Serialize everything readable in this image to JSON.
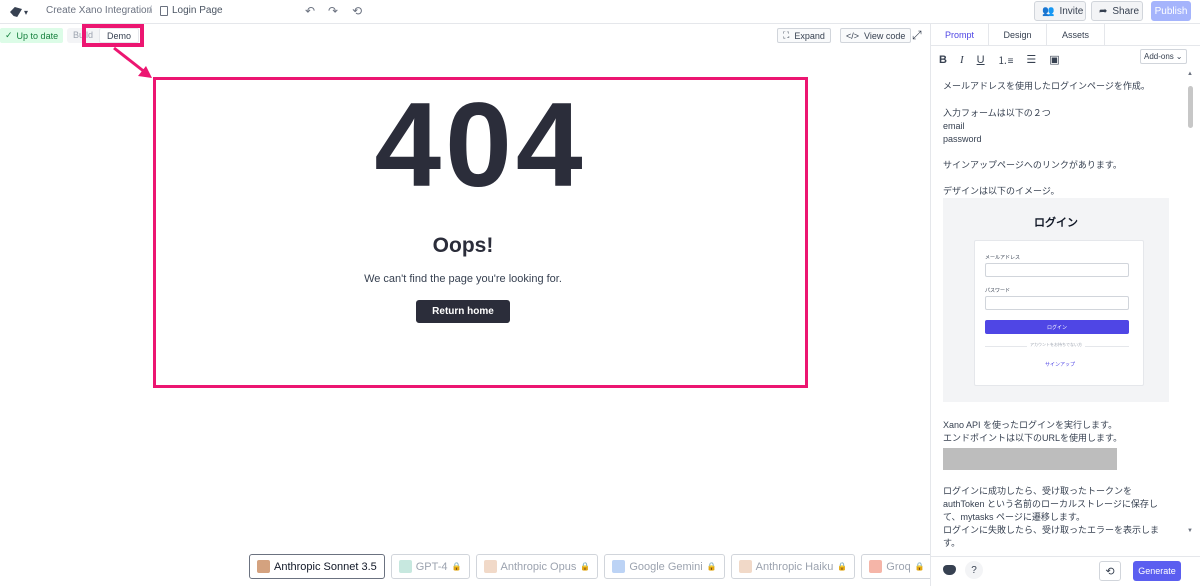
{
  "header": {
    "project": "Create Xano Integration",
    "separator": "/",
    "page": "Login Page",
    "invite": "Invite",
    "share": "Share",
    "publish": "Publish"
  },
  "toolbar": {
    "status": "Up to date",
    "mode_build": "Build",
    "mode_demo": "Demo",
    "expand": "Expand",
    "view_code": "View code"
  },
  "preview": {
    "code": "404",
    "heading": "Oops!",
    "message": "We can't find the page you're looking for.",
    "button": "Return home"
  },
  "models": [
    {
      "label": "Anthropic Sonnet 3.5",
      "active": true,
      "locked": false,
      "color": "#d4a27f"
    },
    {
      "label": "GPT-4",
      "active": false,
      "locked": true,
      "color": "#c7e8df"
    },
    {
      "label": "Anthropic Opus",
      "active": false,
      "locked": true,
      "color": "#f1d9c8"
    },
    {
      "label": "Google Gemini",
      "active": false,
      "locked": true,
      "color": "#bcd3f5"
    },
    {
      "label": "Anthropic Haiku",
      "active": false,
      "locked": true,
      "color": "#f1d9c8"
    },
    {
      "label": "Groq",
      "active": false,
      "locked": true,
      "color": "#f5b5a8"
    }
  ],
  "panel": {
    "tabs": [
      "Prompt",
      "Design",
      "Assets"
    ],
    "addons": "Add-ons",
    "prompt": {
      "line1": "メールアドレスを使用したログインページを作成。",
      "line2": "入力フォームは以下の２つ",
      "line3": "email",
      "line4": "password",
      "line5": "サインアップページへのリンクがあります。",
      "line6": "デザインは以下のイメージ。",
      "line7": "Xano API を使ったログインを実行します。",
      "line8": "エンドポイントは以下のURLを使用します。",
      "line9": "ログインに成功したら、受け取ったトークンを",
      "line10": "authToken という名前のローカルストレージに保存し",
      "line11": "て、mytasks ページに遷移します。",
      "line12": "ログインに失敗したら、受け取ったエラーを表示しま",
      "line13": "す。"
    },
    "mock": {
      "title": "ログイン",
      "email_label": "メールアドレス",
      "password_label": "パスワード",
      "button": "ログイン",
      "divider": "アカウントをお持ちでない方",
      "signup": "サインアップ"
    },
    "generate": "Generate",
    "help": "?"
  }
}
